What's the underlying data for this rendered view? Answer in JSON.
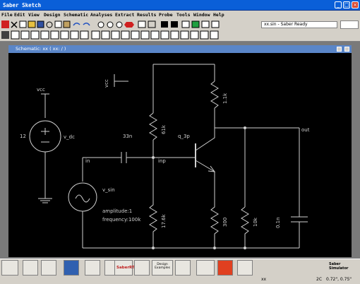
{
  "window": {
    "title": "Saber Sketch"
  },
  "menu": [
    "File",
    "Edit",
    "View",
    "Design",
    "Schematic",
    "Analyses",
    "Extract",
    "Results",
    "Probe",
    "Tools",
    "Window",
    "Help"
  ],
  "status": {
    "text": "xx.sin - Saber Ready"
  },
  "schematic": {
    "title": "Schematic: xx ( xx: / )"
  },
  "labels": {
    "vcc_left": "vcc",
    "vcc_top": "vcc",
    "v12": "12",
    "v_dc": "v_dc",
    "c33": "33n",
    "r61": "61k",
    "r1k": "1.1k",
    "q": "q_3p",
    "out": "out",
    "in": "in",
    "inp": "inp",
    "v_sin": "v_sin",
    "amp": "amplitude:1",
    "freq": "frequency:100k",
    "r17": "17.6k",
    "r300": "300",
    "r10": "10k",
    "c01": "0.1n",
    "saber_sim": "Saber Simulator",
    "saber_rt": "SaberRT",
    "design_examples": "Design Examples",
    "coord_sheet": "xx",
    "coord_grid": "2C",
    "coord_pos": "0.72\", 0.75\""
  }
}
